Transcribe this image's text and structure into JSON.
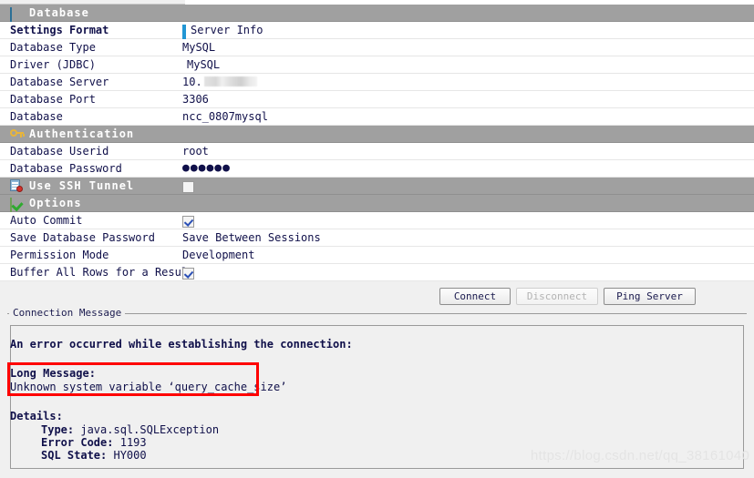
{
  "panel": {
    "sections": [
      {
        "id": "database",
        "title": "Database",
        "icon": "database-icon",
        "rows": [
          {
            "label": "Settings Format",
            "value": "Server Info",
            "icon": "server-info-icon",
            "bold": true
          },
          {
            "label": "Database Type",
            "value": "MySQL"
          },
          {
            "label": "Driver (JDBC)",
            "value": "MySQL",
            "icon": "green-check-circle-icon"
          },
          {
            "label": "Database Server",
            "value": "10.",
            "redacted": true
          },
          {
            "label": "Database Port",
            "value": "3306"
          },
          {
            "label": "Database",
            "value": "ncc_0807mysql"
          }
        ]
      },
      {
        "id": "authentication",
        "title": "Authentication",
        "icon": "key-icon",
        "rows": [
          {
            "label": "Database Userid",
            "value": "root"
          },
          {
            "label": "Database Password",
            "value": "●●●●●●"
          }
        ]
      },
      {
        "id": "ssh-tunnel",
        "title": "Use SSH Tunnel",
        "icon": "ssh-server-icon",
        "checkbox": false,
        "rows": []
      },
      {
        "id": "options",
        "title": "Options",
        "icon": "green-check-box-icon",
        "rows": [
          {
            "label": "Auto Commit",
            "checkbox": true
          },
          {
            "label": "Save Database Password",
            "value": "Save Between Sessions"
          },
          {
            "label": "Permission Mode",
            "value": "Development"
          },
          {
            "label": "Buffer All Rows for a Result",
            "checkbox": true
          }
        ]
      }
    ]
  },
  "buttons": {
    "connect": "Connect",
    "disconnect": "Disconnect",
    "ping_server": "Ping Server"
  },
  "connection_message": {
    "legend": "Connection Message",
    "headline": "An error occurred while establishing the connection:",
    "long_message_label": "Long Message:",
    "long_message_text": "Unknown system variable ‘query_cache_size’",
    "details_label": "Details:",
    "details": [
      {
        "key": "Type:",
        "value": "java.sql.SQLException"
      },
      {
        "key": "Error Code:",
        "value": "1193"
      },
      {
        "key": "SQL State:",
        "value": "HY000"
      }
    ]
  },
  "watermark": "https://blog.csdn.net/qq_38161040",
  "colors": {
    "section_band": "#a0a0a0",
    "error_highlight": "#ff0000",
    "accent_blue": "#46a8e0",
    "success_green": "#17a937"
  }
}
